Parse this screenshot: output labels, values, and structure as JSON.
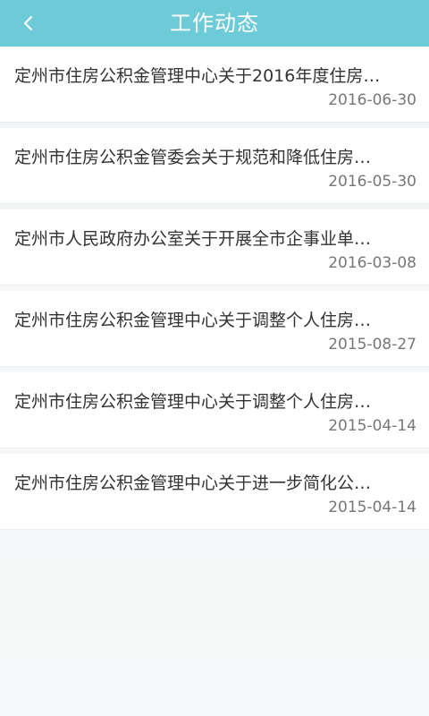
{
  "header": {
    "title": "工作动态",
    "back_icon": "chevron-left-icon",
    "background_color": "#6ccbd6"
  },
  "items": [
    {
      "title": "定州市住房公积金管理中心关于2016年度住房…",
      "date": "2016-06-30"
    },
    {
      "title": "定州市住房公积金管委会关于规范和降低住房…",
      "date": "2016-05-30"
    },
    {
      "title": "定州市人民政府办公室关于开展全市企事业单…",
      "date": "2016-03-08"
    },
    {
      "title": "定州市住房公积金管理中心关于调整个人住房…",
      "date": "2015-08-27"
    },
    {
      "title": "定州市住房公积金管理中心关于调整个人住房…",
      "date": "2015-04-14"
    },
    {
      "title": "定州市住房公积金管理中心关于进一步简化公…",
      "date": "2015-04-14"
    }
  ]
}
